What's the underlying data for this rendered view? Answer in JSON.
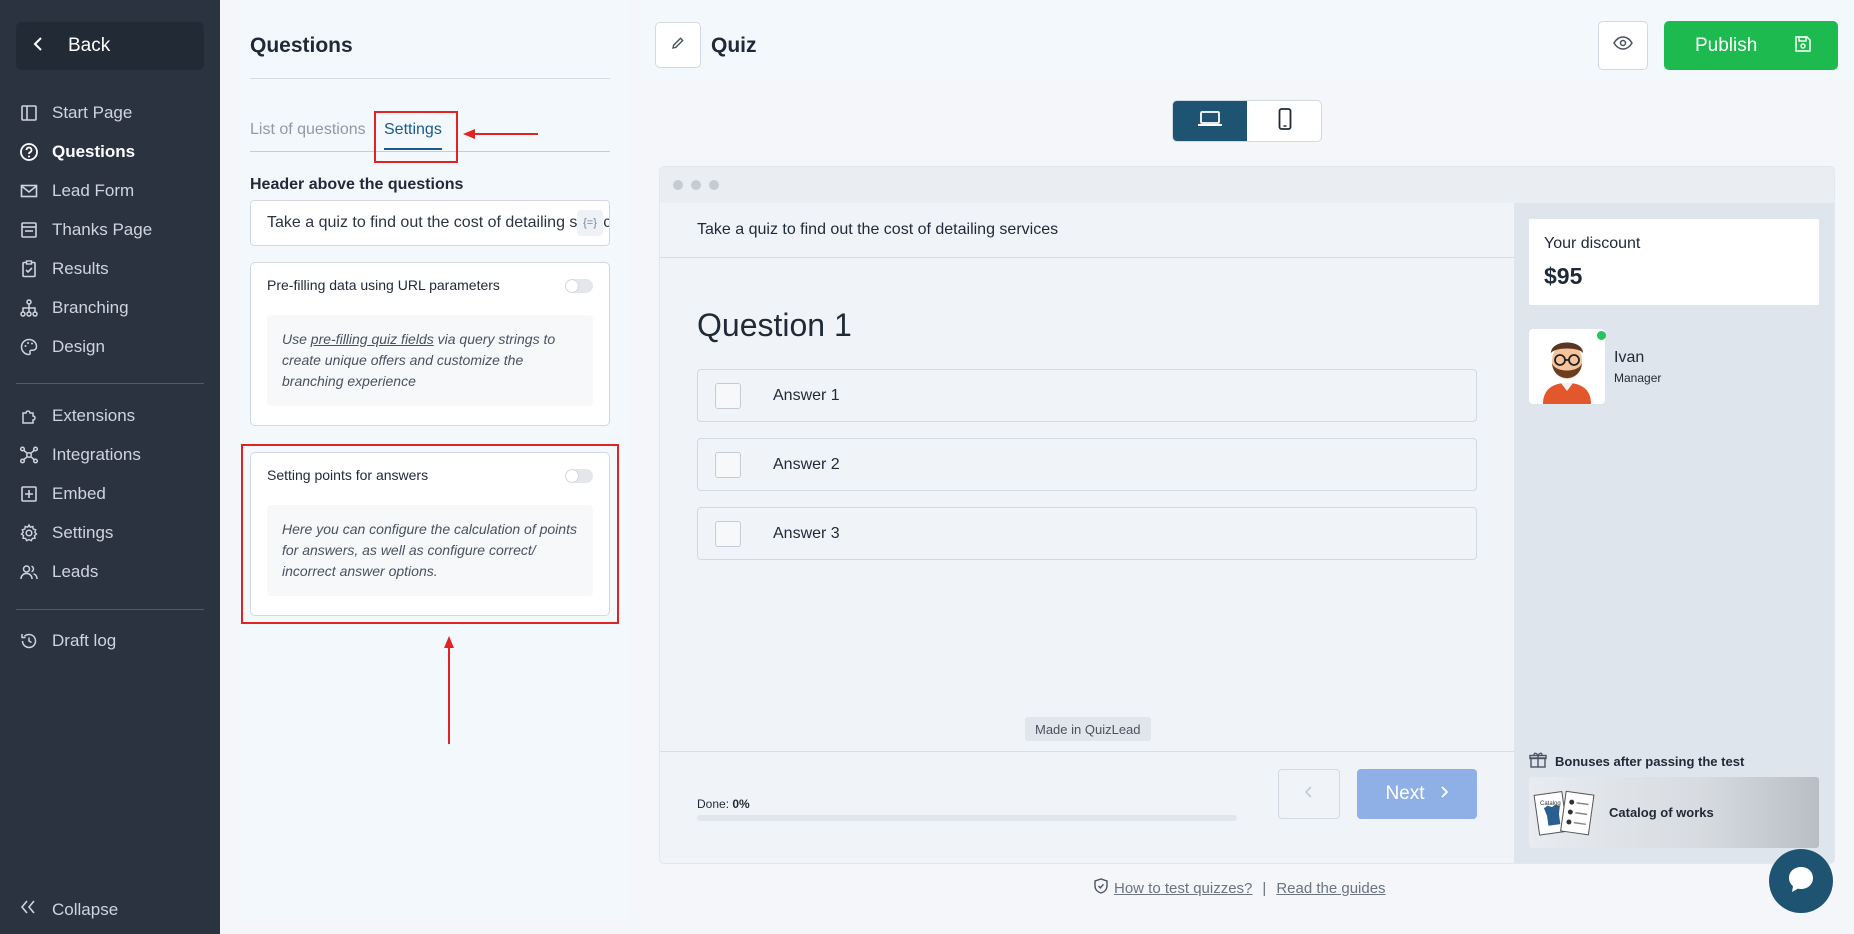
{
  "sidebar": {
    "back_label": "Back",
    "items": [
      {
        "label": "Start Page",
        "icon": "book-icon"
      },
      {
        "label": "Questions",
        "icon": "question-circle-icon",
        "active": true
      },
      {
        "label": "Lead Form",
        "icon": "envelope-icon"
      },
      {
        "label": "Thanks Page",
        "icon": "thanks-page-icon"
      },
      {
        "label": "Results",
        "icon": "clipboard-icon"
      },
      {
        "label": "Branching",
        "icon": "sitemap-icon"
      },
      {
        "label": "Design",
        "icon": "palette-icon"
      }
    ],
    "items2": [
      {
        "label": "Extensions",
        "icon": "puzzle-icon"
      },
      {
        "label": "Integrations",
        "icon": "network-icon"
      },
      {
        "label": "Embed",
        "icon": "plus-square-icon"
      },
      {
        "label": "Settings",
        "icon": "gear-icon"
      },
      {
        "label": "Leads",
        "icon": "users-icon"
      }
    ],
    "items3": [
      {
        "label": "Draft log",
        "icon": "history-icon"
      }
    ],
    "collapse_label": "Collapse"
  },
  "questions_panel": {
    "title": "Questions",
    "tabs": [
      {
        "label": "List of questions",
        "active": false
      },
      {
        "label": "Settings",
        "active": true
      }
    ],
    "header_label": "Header above the questions",
    "header_value": "Take a quiz to find out the cost of detailing services",
    "var_button": "{=}",
    "prefill": {
      "title": "Pre-filling data using URL parameters",
      "note_before": "Use ",
      "note_link": "pre-filling quiz fields",
      "note_after": " via query strings to create unique offers and customize the branching experience"
    },
    "points": {
      "title": "Setting points for answers",
      "note": "Here you can configure the calculation of points for answers, as well as configure correct/ incorrect answer options."
    }
  },
  "topbar": {
    "quiz_title": "Quiz",
    "publish_label": "Publish"
  },
  "preview": {
    "header": "Take a quiz to find out the cost of detailing services",
    "question": "Question 1",
    "answers": [
      "Answer 1",
      "Answer 2",
      "Answer 3"
    ],
    "made_in": "Made in QuizLead",
    "done_label": "Done:",
    "done_value": "0%",
    "progress": 0,
    "next_label": "Next",
    "discount_label": "Your discount",
    "discount_value": "$95",
    "manager_name": "Ivan",
    "manager_role": "Manager",
    "bonus_title": "Bonuses after passing the test",
    "bonus_item": "Catalog of works",
    "bonus_thumb_label": "Catalog"
  },
  "footer": {
    "link1": "How to test quizzes?",
    "separator": "|",
    "link2": "Read the guides"
  },
  "colors": {
    "sidebar_bg": "#2b3340",
    "publish": "#1dbb4f",
    "accent": "#1e5472",
    "highlight": "#e02424"
  }
}
